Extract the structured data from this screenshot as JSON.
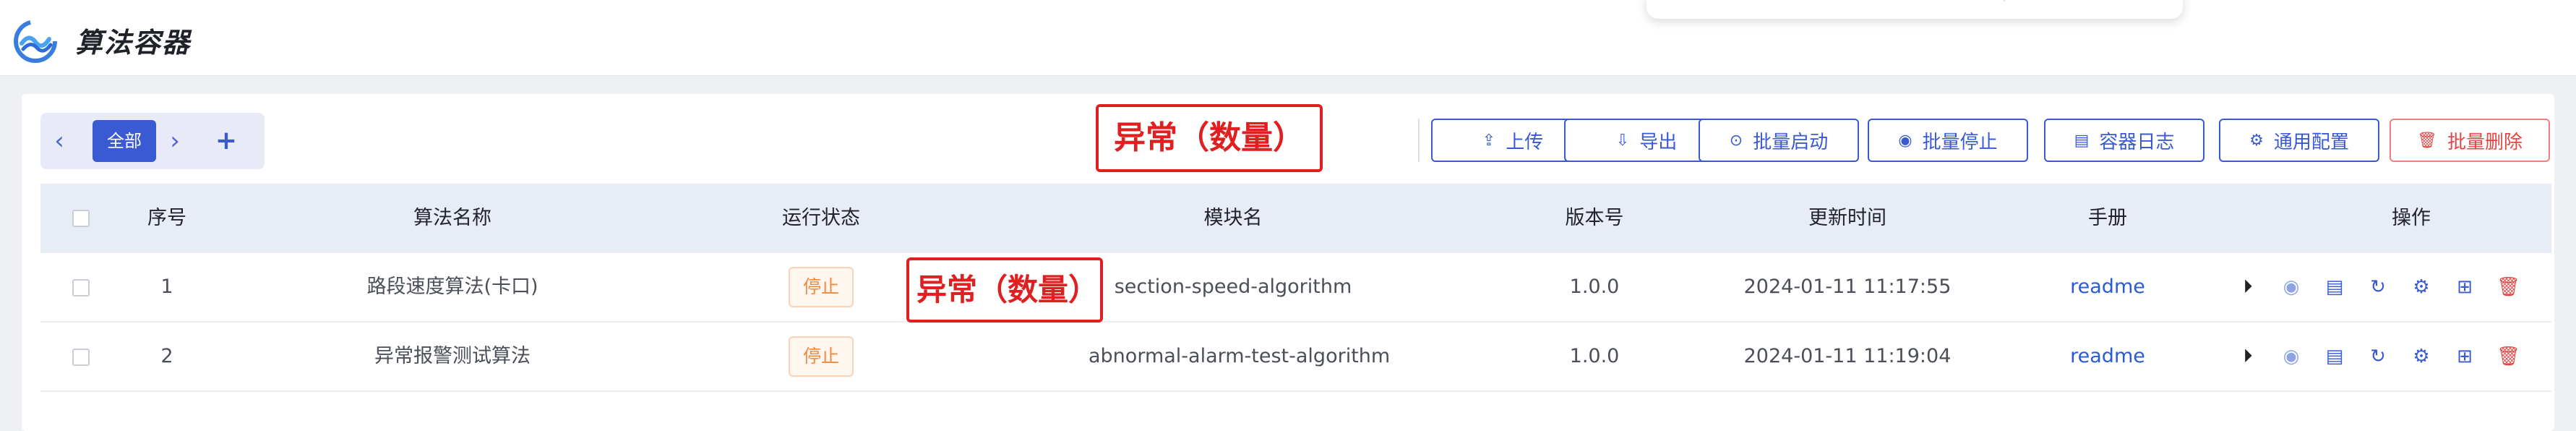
{
  "header": {
    "title": "算法容器",
    "logo_icon": "wave-logo-icon"
  },
  "tabs": {
    "active_label": "全部",
    "prev_icon": "chevron-left-icon",
    "next_icon": "chevron-right-icon",
    "add_icon": "plus-icon"
  },
  "annotation": {
    "text": "异常（数量）"
  },
  "toolbar": {
    "upload": "上传",
    "export": "导出",
    "batch_start": "批量启动",
    "batch_stop": "批量停止",
    "container_log": "容器日志",
    "general_config": "通用配置",
    "batch_delete": "批量删除"
  },
  "table": {
    "columns": [
      "序号",
      "算法名称",
      "运行状态",
      "模块名",
      "版本号",
      "更新时间",
      "手册",
      "操作"
    ],
    "rows": [
      {
        "index": "1",
        "name": "路段速度算法(卡口)",
        "status": "停止",
        "module": "section-speed-algorithm",
        "version": "1.0.0",
        "updated": "2024-01-11 11:17:55",
        "manual": "readme"
      },
      {
        "index": "2",
        "name": "异常报警测试算法",
        "status": "停止",
        "module": "abnormal-alarm-test-algorithm",
        "version": "1.0.0",
        "updated": "2024-01-11 11:19:04",
        "manual": "readme"
      }
    ]
  },
  "colors": {
    "primary": "#3a5ad4",
    "danger": "#e54545",
    "status_stop": "#f08a3e",
    "annotation": "#e02020"
  }
}
